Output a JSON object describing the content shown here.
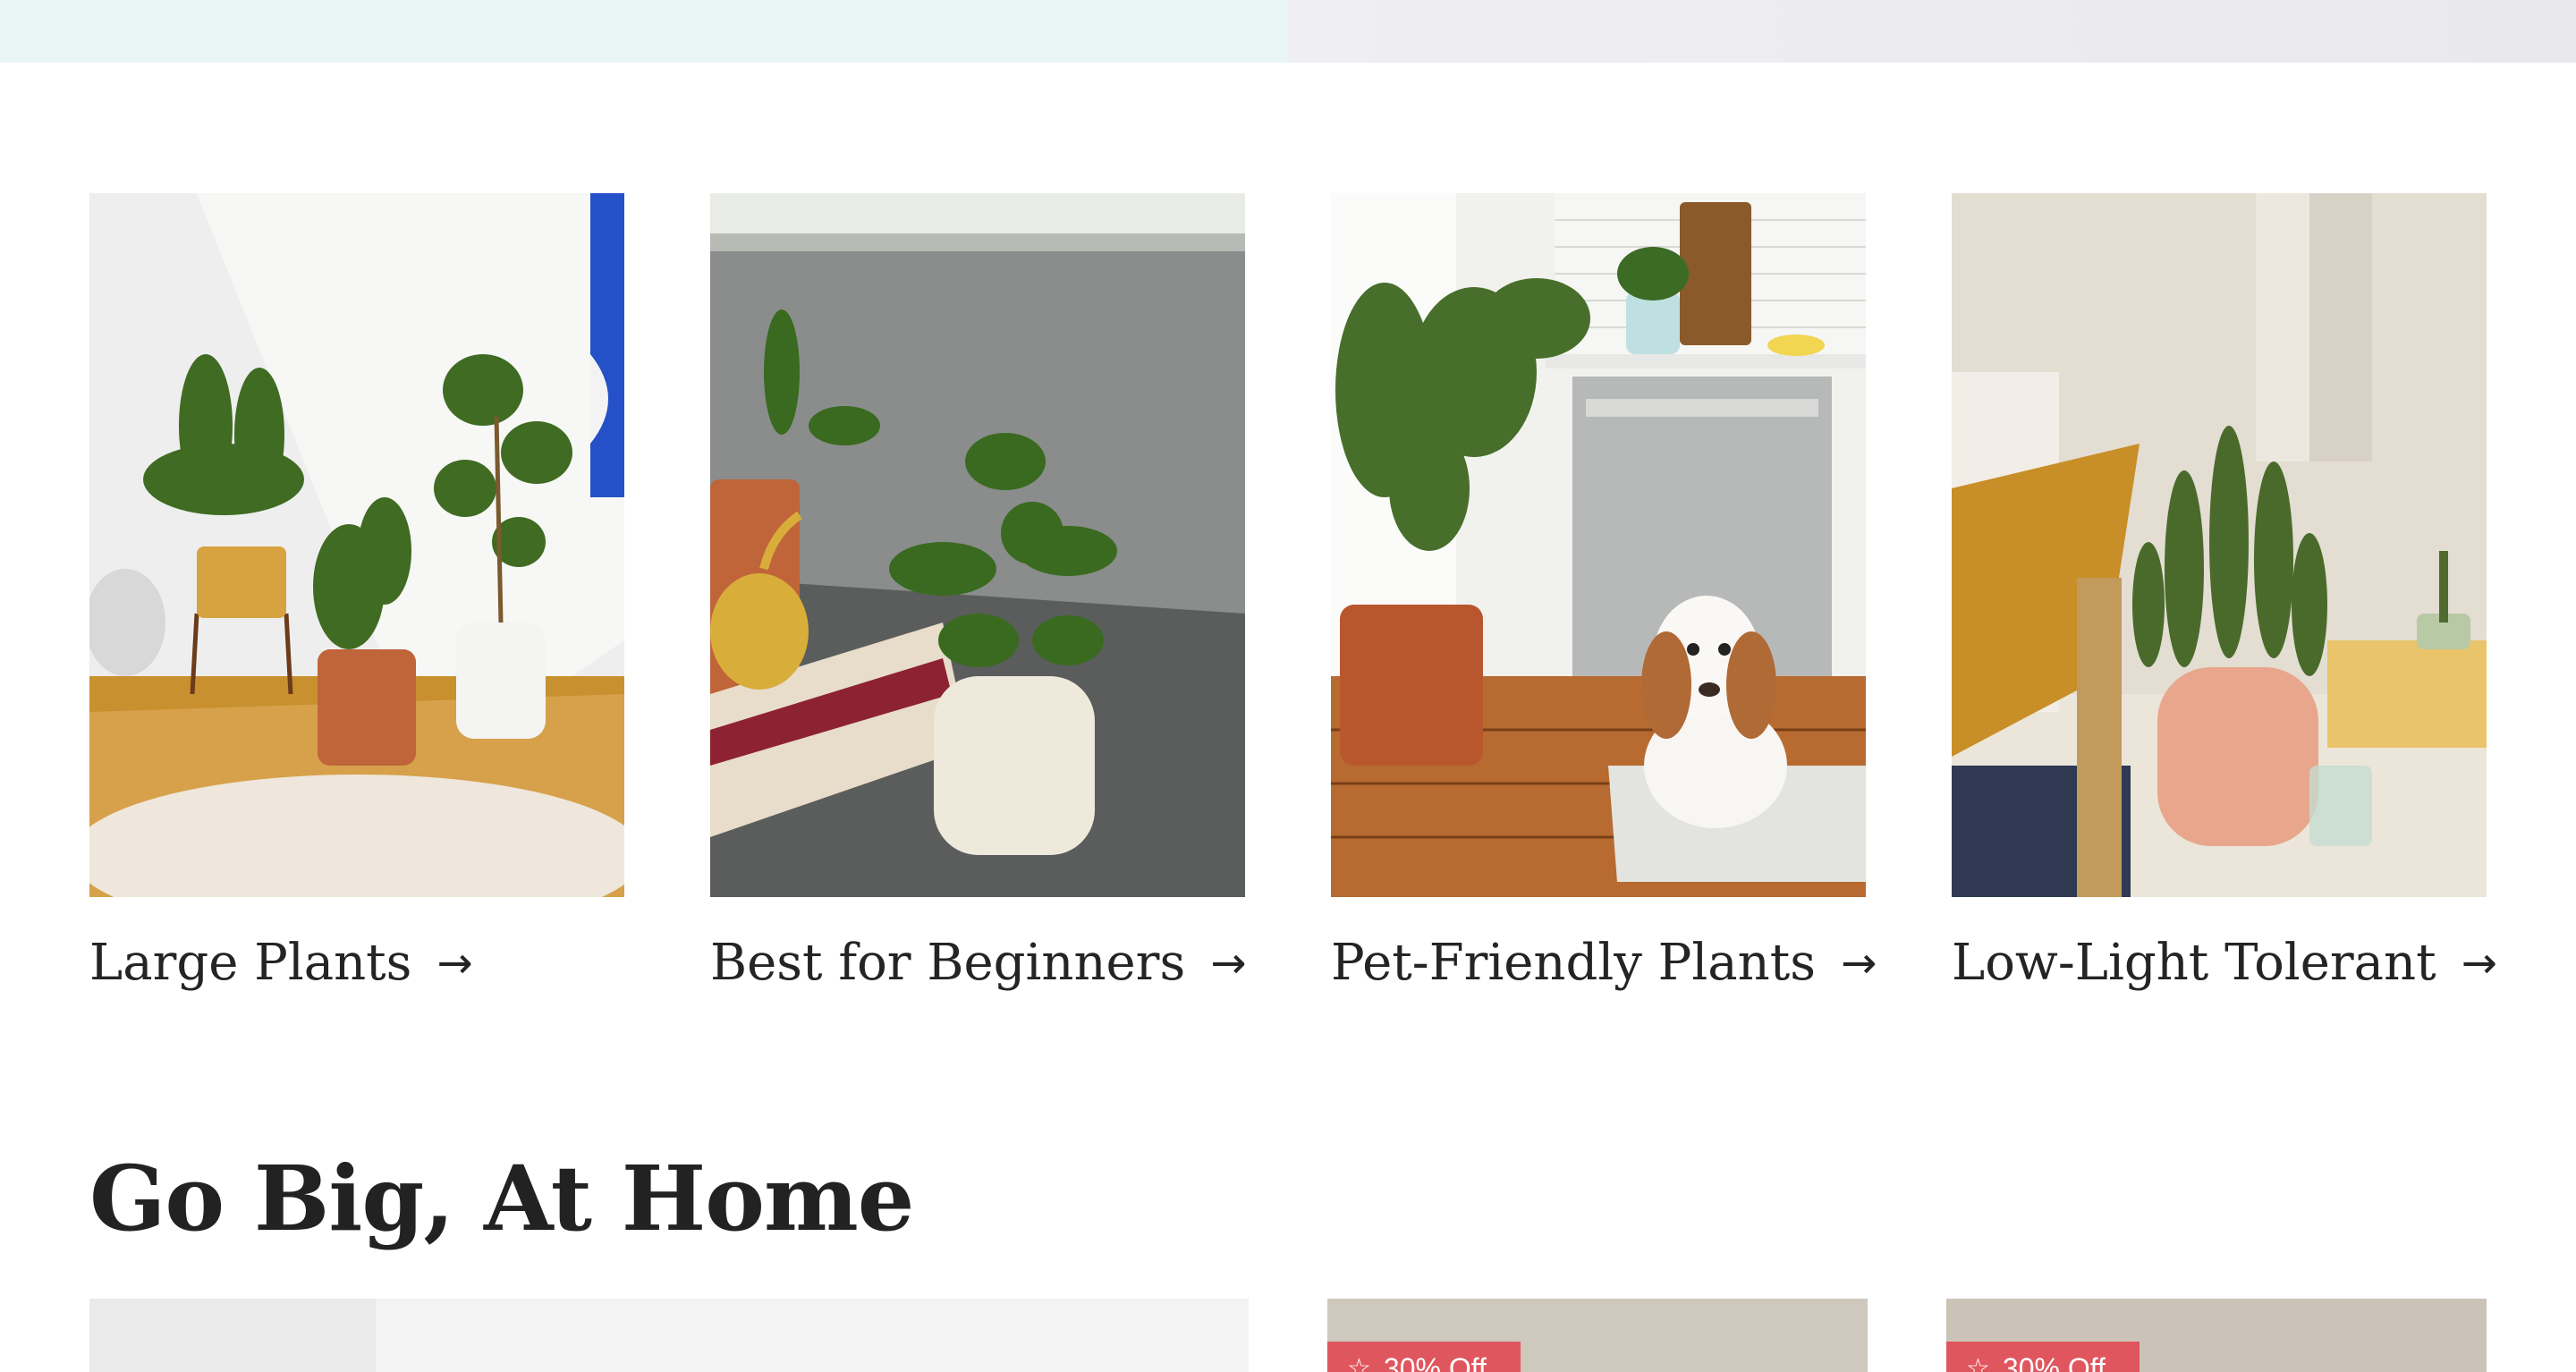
{
  "categories": [
    {
      "label": "Large Plants",
      "arrow": "→"
    },
    {
      "label": "Best for Beginners",
      "arrow": "→"
    },
    {
      "label": "Pet-Friendly Plants",
      "arrow": "→"
    },
    {
      "label": "Low-Light Tolerant",
      "arrow": "→"
    }
  ],
  "section": {
    "title": "Go Big, At Home"
  },
  "products": [
    {
      "badge": ""
    },
    {
      "badge": "30% Off",
      "badge_icon": "star-icon"
    },
    {
      "badge": "30% Off",
      "badge_icon": "star-icon"
    }
  ],
  "colors": {
    "accent_badge": "#e0565e",
    "text": "#242424"
  }
}
